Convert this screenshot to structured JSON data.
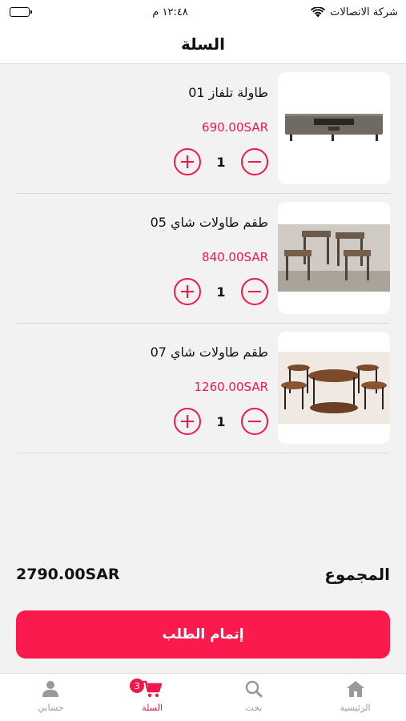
{
  "status_bar": {
    "time": "١٢:٤٨ م",
    "carrier": "شركة الاتصالات",
    "icons": [
      "battery-icon",
      "wifi-icon"
    ]
  },
  "header": {
    "title": "السلة"
  },
  "cart_items": [
    {
      "title": "طاولة تلفاز 01",
      "price": "690.00SAR",
      "quantity": "1",
      "image": "tv-table"
    },
    {
      "title": "طقم طاولات شاي 05",
      "price": "840.00SAR",
      "quantity": "1",
      "image": "tea-tables-set"
    },
    {
      "title": "طقم طاولات شاي 07",
      "price": "1260.00SAR",
      "quantity": "1",
      "image": "round-tea-tables"
    }
  ],
  "summary": {
    "total_label": "المجموع",
    "total_amount": "2790.00SAR"
  },
  "checkout": {
    "label": "إتمام الطلب"
  },
  "tab_bar": {
    "tabs": [
      {
        "label": "حسابي",
        "icon": "person-icon"
      },
      {
        "label": "السلة",
        "icon": "cart-icon",
        "badge": "3"
      },
      {
        "label": "بحث",
        "icon": "search-icon"
      },
      {
        "label": "الرئيسية",
        "icon": "home-icon"
      }
    ],
    "active_tab": "السلة"
  },
  "colors": {
    "accent": "#f0184a",
    "button": "#fb1a4d",
    "background": "#f2f2f2"
  }
}
